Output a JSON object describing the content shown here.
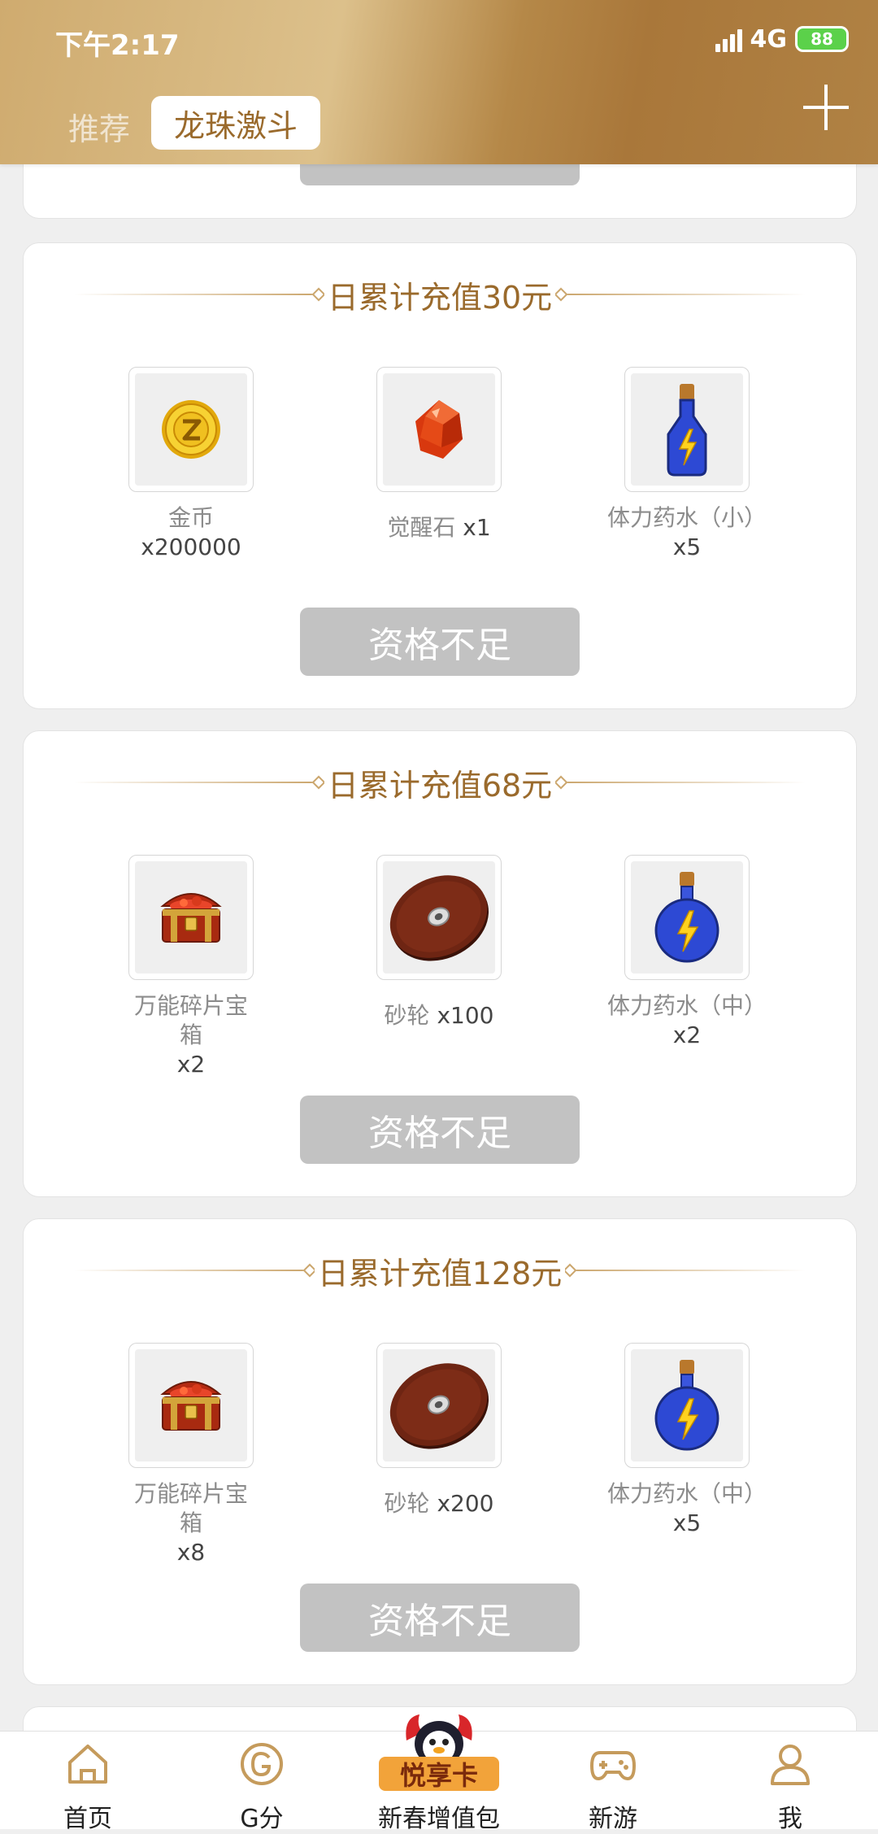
{
  "status": {
    "time": "下午2:17",
    "network": "4G",
    "battery": "88"
  },
  "header": {
    "tab_recommend": "推荐",
    "tab_active": "龙珠激斗"
  },
  "cards": [
    {
      "title": "日累计充值30元",
      "items": [
        {
          "icon": "gold-coin-icon",
          "label": "金币",
          "qty": "x200000"
        },
        {
          "icon": "awakening-stone-icon",
          "label": "觉醒石",
          "qty": "x1"
        },
        {
          "icon": "stamina-potion-small-icon",
          "label": "体力药水（小）",
          "qty": "x5"
        }
      ],
      "button": "资格不足"
    },
    {
      "title": "日累计充值68元",
      "items": [
        {
          "icon": "treasure-chest-icon",
          "label": "万能碎片宝箱",
          "qty": "x2"
        },
        {
          "icon": "grinding-wheel-icon",
          "label": "砂轮",
          "qty": "x100"
        },
        {
          "icon": "stamina-potion-medium-icon",
          "label": "体力药水（中）",
          "qty": "x2"
        }
      ],
      "button": "资格不足"
    },
    {
      "title": "日累计充值128元",
      "items": [
        {
          "icon": "treasure-chest-icon",
          "label": "万能碎片宝箱",
          "qty": "x8"
        },
        {
          "icon": "grinding-wheel-icon",
          "label": "砂轮",
          "qty": "x200"
        },
        {
          "icon": "stamina-potion-medium-icon",
          "label": "体力药水（中）",
          "qty": "x5"
        }
      ],
      "button": "资格不足"
    }
  ],
  "nav": {
    "home": "首页",
    "gscore": "G分",
    "promo_badge": "悦享卡",
    "promo": "新春增值包",
    "games": "新游",
    "me": "我"
  },
  "colors": {
    "accent": "#9a6a2c",
    "header_gold": "#b88a4b",
    "disabled": "#c2c2c2"
  }
}
